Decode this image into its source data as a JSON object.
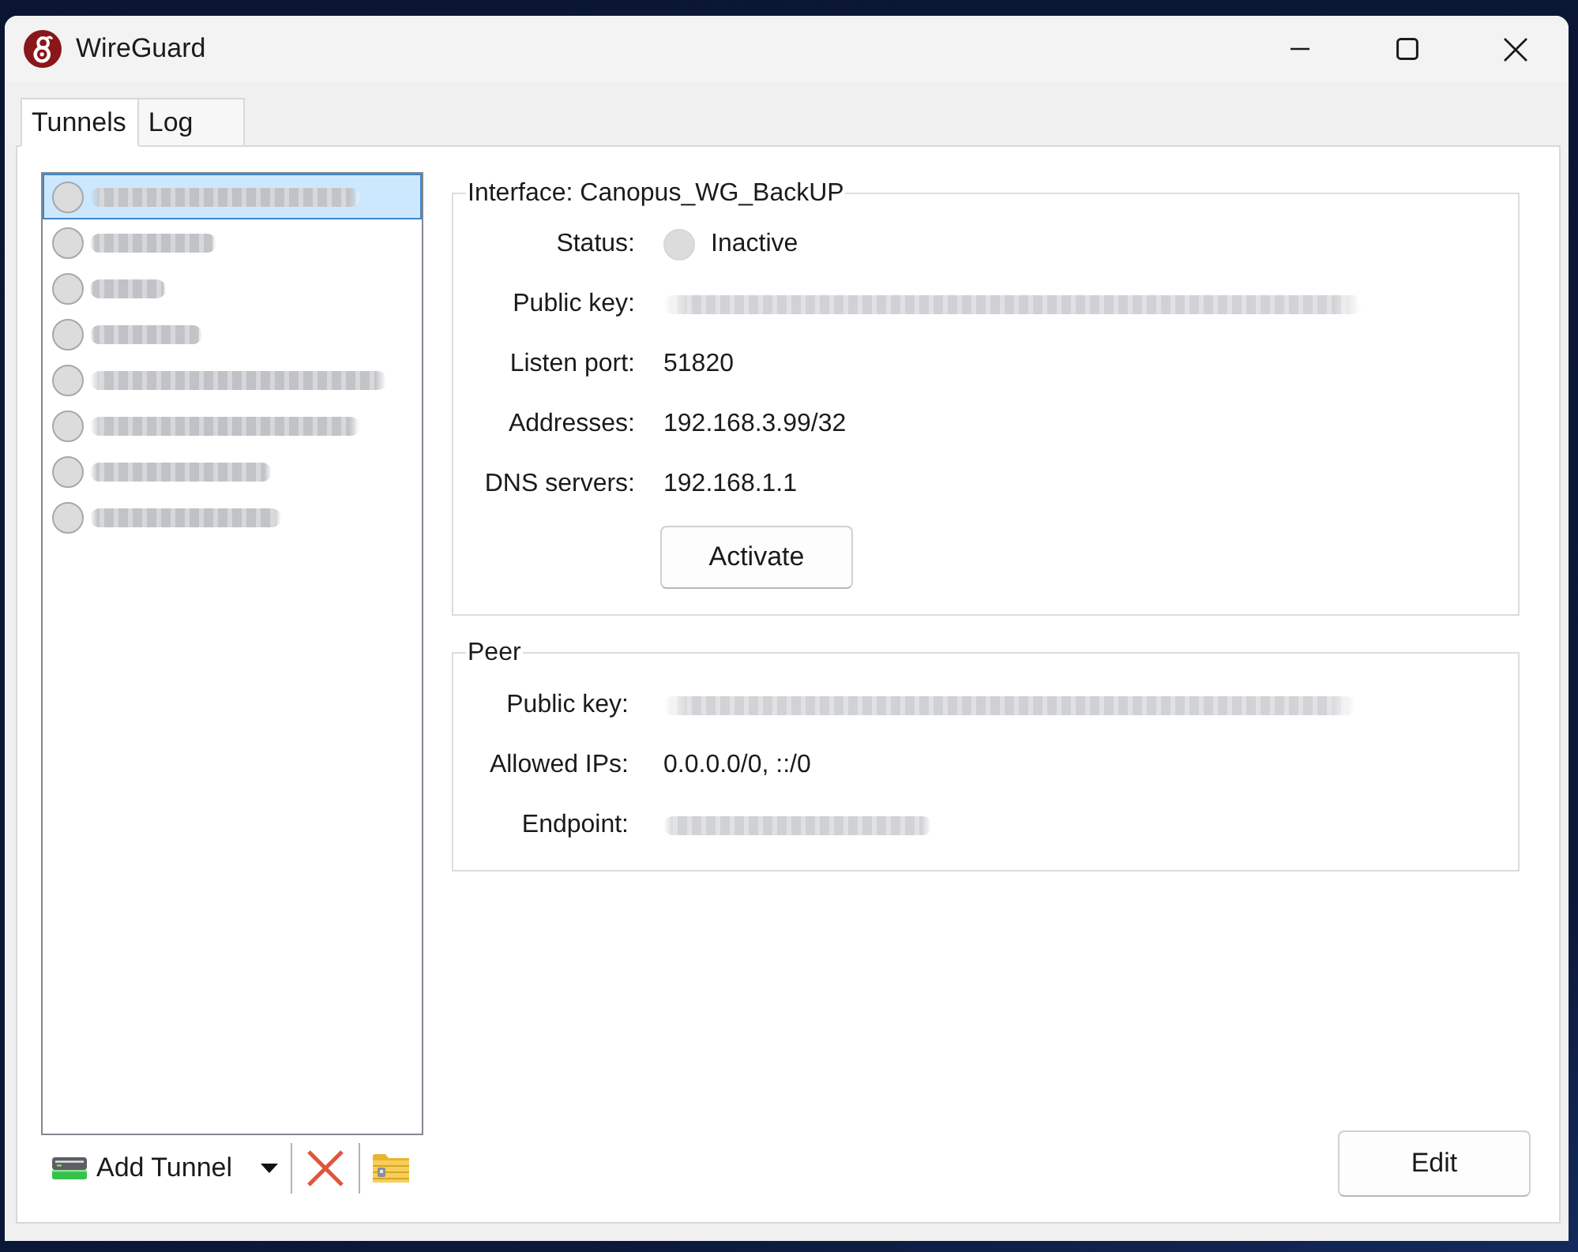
{
  "window": {
    "title": "WireGuard"
  },
  "tabs": [
    {
      "label": "Tunnels",
      "selected": true
    },
    {
      "label": "Log",
      "selected": false
    }
  ],
  "tunnels": [
    {
      "selected": true,
      "active": false
    },
    {
      "selected": false,
      "active": false
    },
    {
      "selected": false,
      "active": false
    },
    {
      "selected": false,
      "active": false
    },
    {
      "selected": false,
      "active": false
    },
    {
      "selected": false,
      "active": false
    },
    {
      "selected": false,
      "active": false
    },
    {
      "selected": false,
      "active": false
    }
  ],
  "toolbar": {
    "add_tunnel": "Add Tunnel"
  },
  "interface": {
    "title": "Interface: Canopus_WG_BackUP",
    "fields": [
      {
        "label": "Status:",
        "kind": "status",
        "value": "Inactive",
        "active": false
      },
      {
        "label": "Public key:",
        "kind": "blurred"
      },
      {
        "label": "Listen port:",
        "kind": "text",
        "value": "51820"
      },
      {
        "label": "Addresses:",
        "kind": "text",
        "value": "192.168.3.99/32"
      },
      {
        "label": "DNS servers:",
        "kind": "text",
        "value": "192.168.1.1"
      }
    ],
    "activate_button": "Activate"
  },
  "peer": {
    "title": "Peer",
    "fields": [
      {
        "label": "Public key:",
        "kind": "blurred"
      },
      {
        "label": "Allowed IPs:",
        "kind": "text",
        "value": "0.0.0.0/0, ::/0"
      },
      {
        "label": "Endpoint:",
        "kind": "blurred"
      }
    ]
  },
  "edit_button": "Edit"
}
